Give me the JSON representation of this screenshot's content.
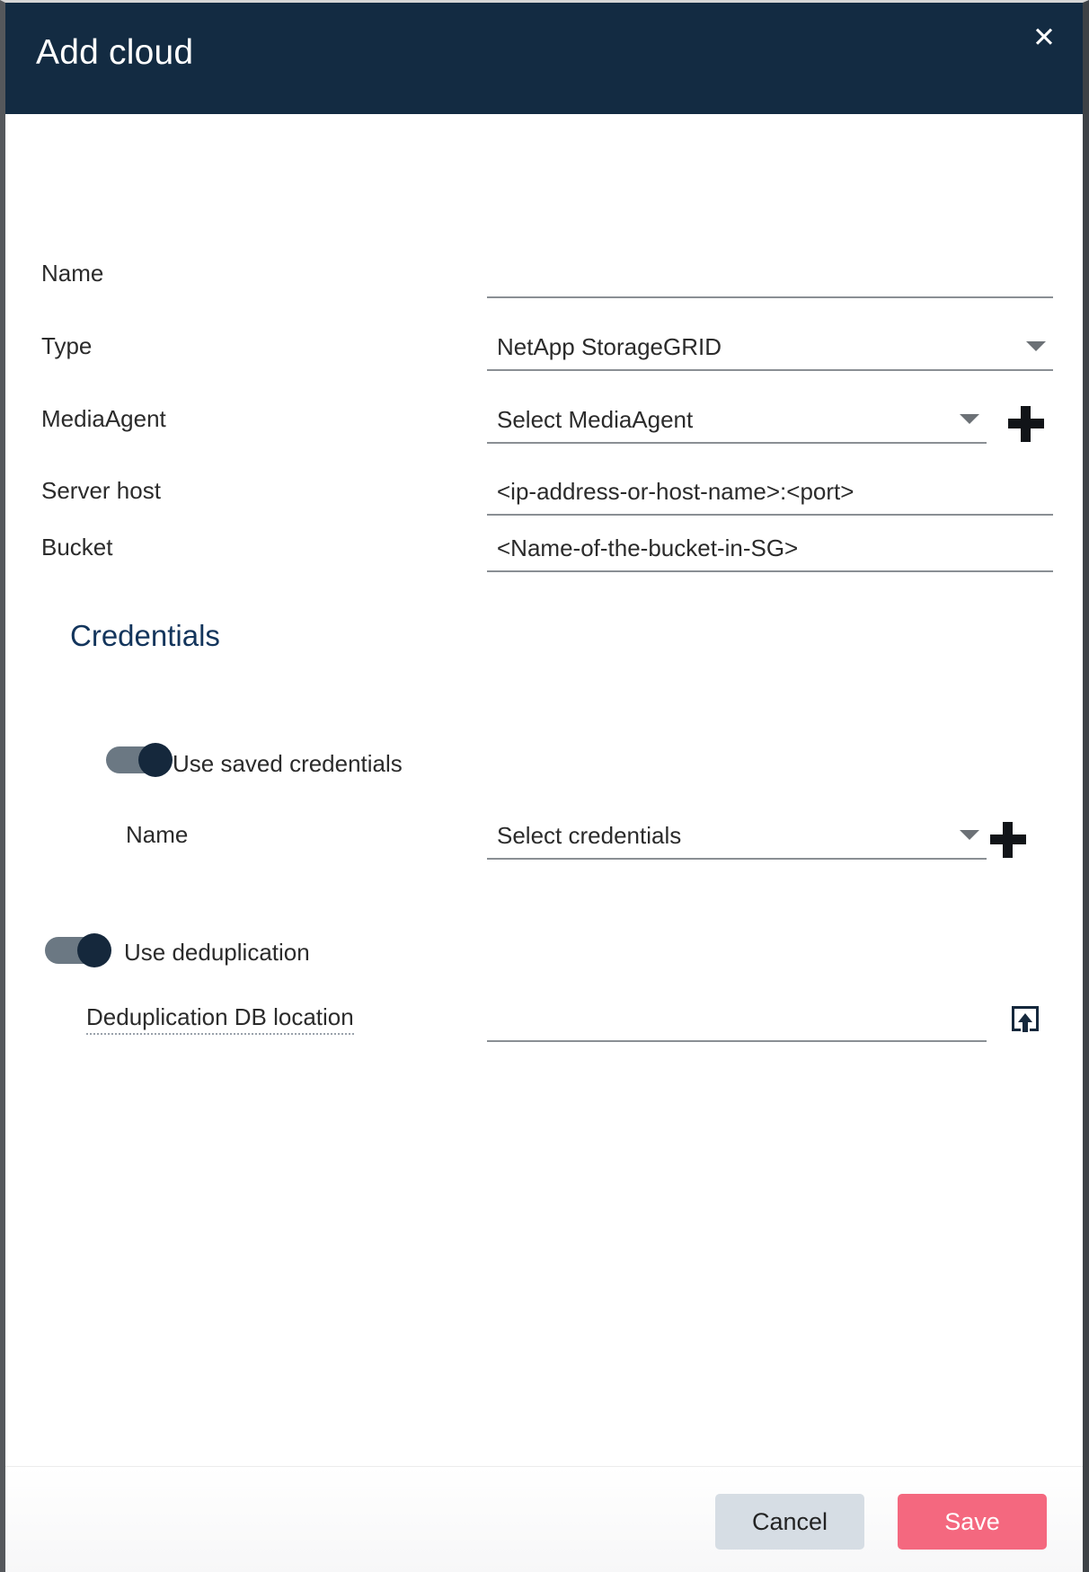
{
  "dialog": {
    "title": "Add cloud",
    "close_icon": "close-icon",
    "accent_header_color": "#132b42",
    "save_color": "#f4687f",
    "cancel_color": "#d6dde4"
  },
  "form": {
    "name": {
      "label": "Name",
      "value": "",
      "placeholder": ""
    },
    "type": {
      "label": "Type",
      "value": "NetApp StorageGRID",
      "icon": "chevron-down-icon"
    },
    "media_agent": {
      "label": "MediaAgent",
      "value": "Select MediaAgent",
      "icon": "chevron-down-icon",
      "add_icon": "plus-icon"
    },
    "server_host": {
      "label": "Server host",
      "value": "<ip-address-or-host-name>:<port>"
    },
    "bucket": {
      "label": "Bucket",
      "value": "<Name-of-the-bucket-in-SG>"
    }
  },
  "credentials": {
    "heading": "Credentials",
    "use_saved_toggle": {
      "label": "Use saved credentials",
      "state": "on"
    },
    "name": {
      "label": "Name",
      "value": "Select credentials",
      "icon": "chevron-down-icon",
      "add_icon": "plus-icon"
    }
  },
  "deduplication": {
    "toggle": {
      "label": "Use deduplication",
      "state": "on"
    },
    "db_location": {
      "label": "Deduplication DB location",
      "value": "",
      "browse_icon": "browse-upload-icon"
    }
  },
  "footer": {
    "cancel_label": "Cancel",
    "save_label": "Save"
  }
}
